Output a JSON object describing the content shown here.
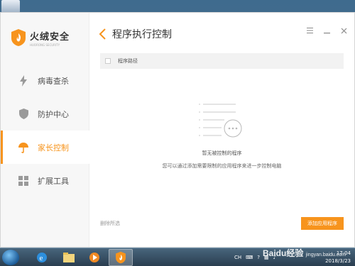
{
  "app": {
    "logo_title": "火绒安全",
    "logo_subtitle": "HUORONG SECURITY",
    "accent_color": "#f7941d"
  },
  "sidebar": {
    "items": [
      {
        "label": "病毒查杀",
        "icon": "lightning-icon",
        "active": false
      },
      {
        "label": "防护中心",
        "icon": "shield-icon",
        "active": false
      },
      {
        "label": "家长控制",
        "icon": "umbrella-icon",
        "active": true
      },
      {
        "label": "扩展工具",
        "icon": "grid-icon",
        "active": false
      }
    ]
  },
  "header": {
    "title": "程序执行控制",
    "back_icon": "chevron-left-icon",
    "controls": [
      "menu-icon",
      "minimize-icon",
      "close-icon"
    ]
  },
  "table": {
    "columns": [
      "程序路径"
    ]
  },
  "empty_state": {
    "icon": "document-list-icon",
    "title": "暂无被控制的程序",
    "description": "您可以通过添加需要限制的应用程序来进一步控制电脑"
  },
  "footer": {
    "delete_label": "删除所选",
    "add_label": "添加应用程序"
  },
  "taskbar": {
    "apps": [
      "ie-icon",
      "file-explorer-icon",
      "media-player-icon",
      "huorong-icon"
    ],
    "tray_lang": "CH",
    "time": "17:04",
    "date": "2018/3/23"
  },
  "watermark": {
    "brand": "Baidu经验",
    "url": "jingyan.baidu.com"
  }
}
